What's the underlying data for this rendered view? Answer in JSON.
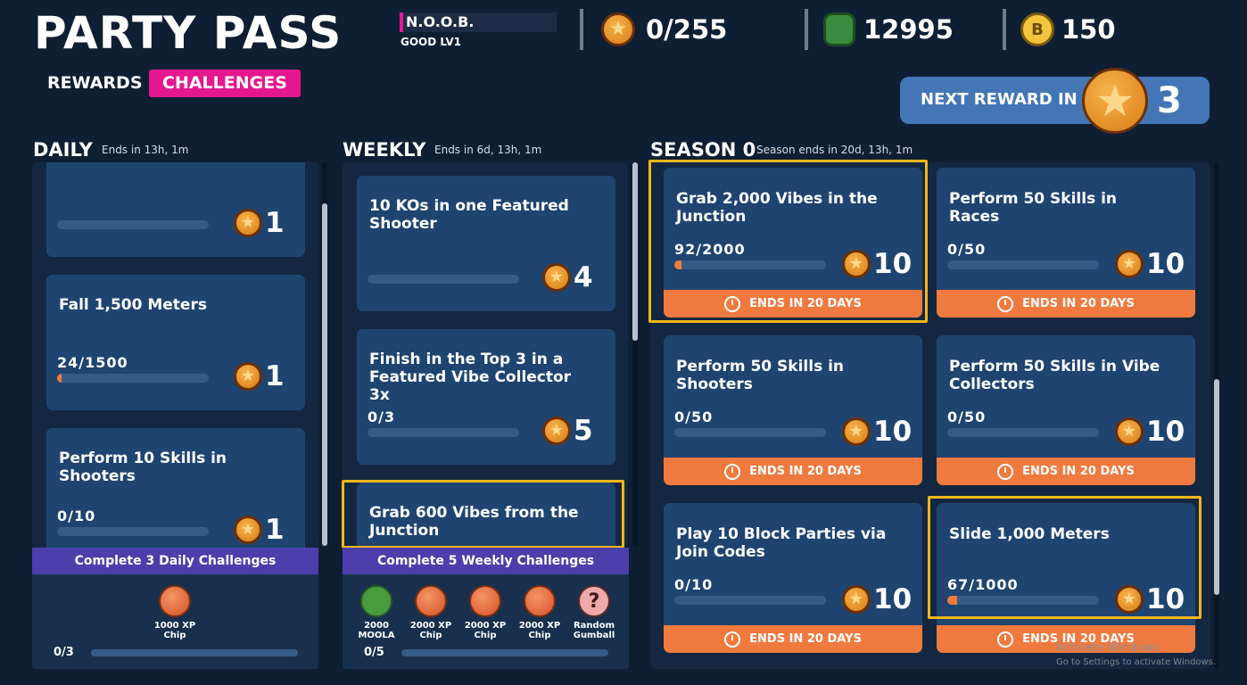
{
  "header": {
    "title": "PARTY PASS",
    "player_name": "N.O.O.B.",
    "player_level": "GOOD LV1",
    "stars": "0/255",
    "moola": "12995",
    "gumballs": "150",
    "star_icon_glyph": "★",
    "gum_icon_glyph": "B"
  },
  "tabs": [
    {
      "label": "REWARDS",
      "active": false
    },
    {
      "label": "CHALLENGES",
      "active": true
    }
  ],
  "next_reward": {
    "label": "NEXT REWARD IN",
    "value": "3"
  },
  "daily": {
    "title": "DAILY",
    "subtitle": "Ends in 13h, 1m",
    "cards": [
      {
        "title": "",
        "progress": "",
        "reward": "1",
        "fraction": 0
      },
      {
        "title": "Fall 1,500 Meters",
        "progress": "24/1500",
        "reward": "1",
        "fraction": 0.016
      },
      {
        "title": "Perform 10 Skills in Shooters",
        "progress": "0/10",
        "reward": "1",
        "fraction": 0
      }
    ],
    "bonus": {
      "label": "Complete 3 Daily Challenges",
      "items": [
        {
          "name": "1000 XP Chip",
          "icon": "xp-chip-icon"
        }
      ],
      "progress": "0/3"
    }
  },
  "weekly": {
    "title": "WEEKLY",
    "subtitle": "Ends in 6d, 13h, 1m",
    "cards": [
      {
        "title": "10 KOs in one Featured Shooter",
        "progress": "",
        "reward": "4",
        "fraction": 0
      },
      {
        "title": "Finish in the Top 3 in a Featured Vibe Collector 3x",
        "progress": "0/3",
        "reward": "5",
        "fraction": 0
      },
      {
        "title": "Grab 600 Vibes from the Junction",
        "progress": "",
        "reward": "",
        "fraction": 0
      }
    ],
    "bonus": {
      "label": "Complete 5 Weekly Challenges",
      "items": [
        {
          "name": "2000 MOOLA",
          "icon": "moola-icon"
        },
        {
          "name": "2000 XP Chip",
          "icon": "xp-chip-icon"
        },
        {
          "name": "2000 XP Chip",
          "icon": "xp-chip-icon"
        },
        {
          "name": "2000 XP Chip",
          "icon": "xp-chip-icon"
        },
        {
          "name": "Random Gumball",
          "icon": "random-gumball-icon",
          "glyph": "?"
        }
      ],
      "progress": "0/5"
    }
  },
  "season": {
    "title": "SEASON 0",
    "subtitle": "Season ends in 20d, 13h, 1m",
    "ends_label": "ENDS IN 20 DAYS",
    "cards": [
      {
        "title": "Grab 2,000 Vibes in the Junction",
        "progress": "92/2000",
        "reward": "10",
        "fraction": 0.046
      },
      {
        "title": "Perform 50 Skills in Races",
        "progress": "0/50",
        "reward": "10",
        "fraction": 0
      },
      {
        "title": "Perform 50 Skills in Shooters",
        "progress": "0/50",
        "reward": "10",
        "fraction": 0
      },
      {
        "title": "Perform 50 Skills in Vibe Collectors",
        "progress": "0/50",
        "reward": "10",
        "fraction": 0
      },
      {
        "title": "Play 10 Block Parties via Join Codes",
        "progress": "0/10",
        "reward": "10",
        "fraction": 0
      },
      {
        "title": "Slide 1,000 Meters",
        "progress": "67/1000",
        "reward": "10",
        "fraction": 0.067
      }
    ]
  },
  "watermark": {
    "line1": "Activate Windows",
    "line2": "Go to Settings to activate Windows."
  },
  "colors": {
    "background": "#0f1f33",
    "card": "#1f4470",
    "accent_pink": "#e5178f",
    "orange": "#ef7a3f",
    "highlight": "#f2b51b",
    "bonus_header": "#4b3fab"
  }
}
